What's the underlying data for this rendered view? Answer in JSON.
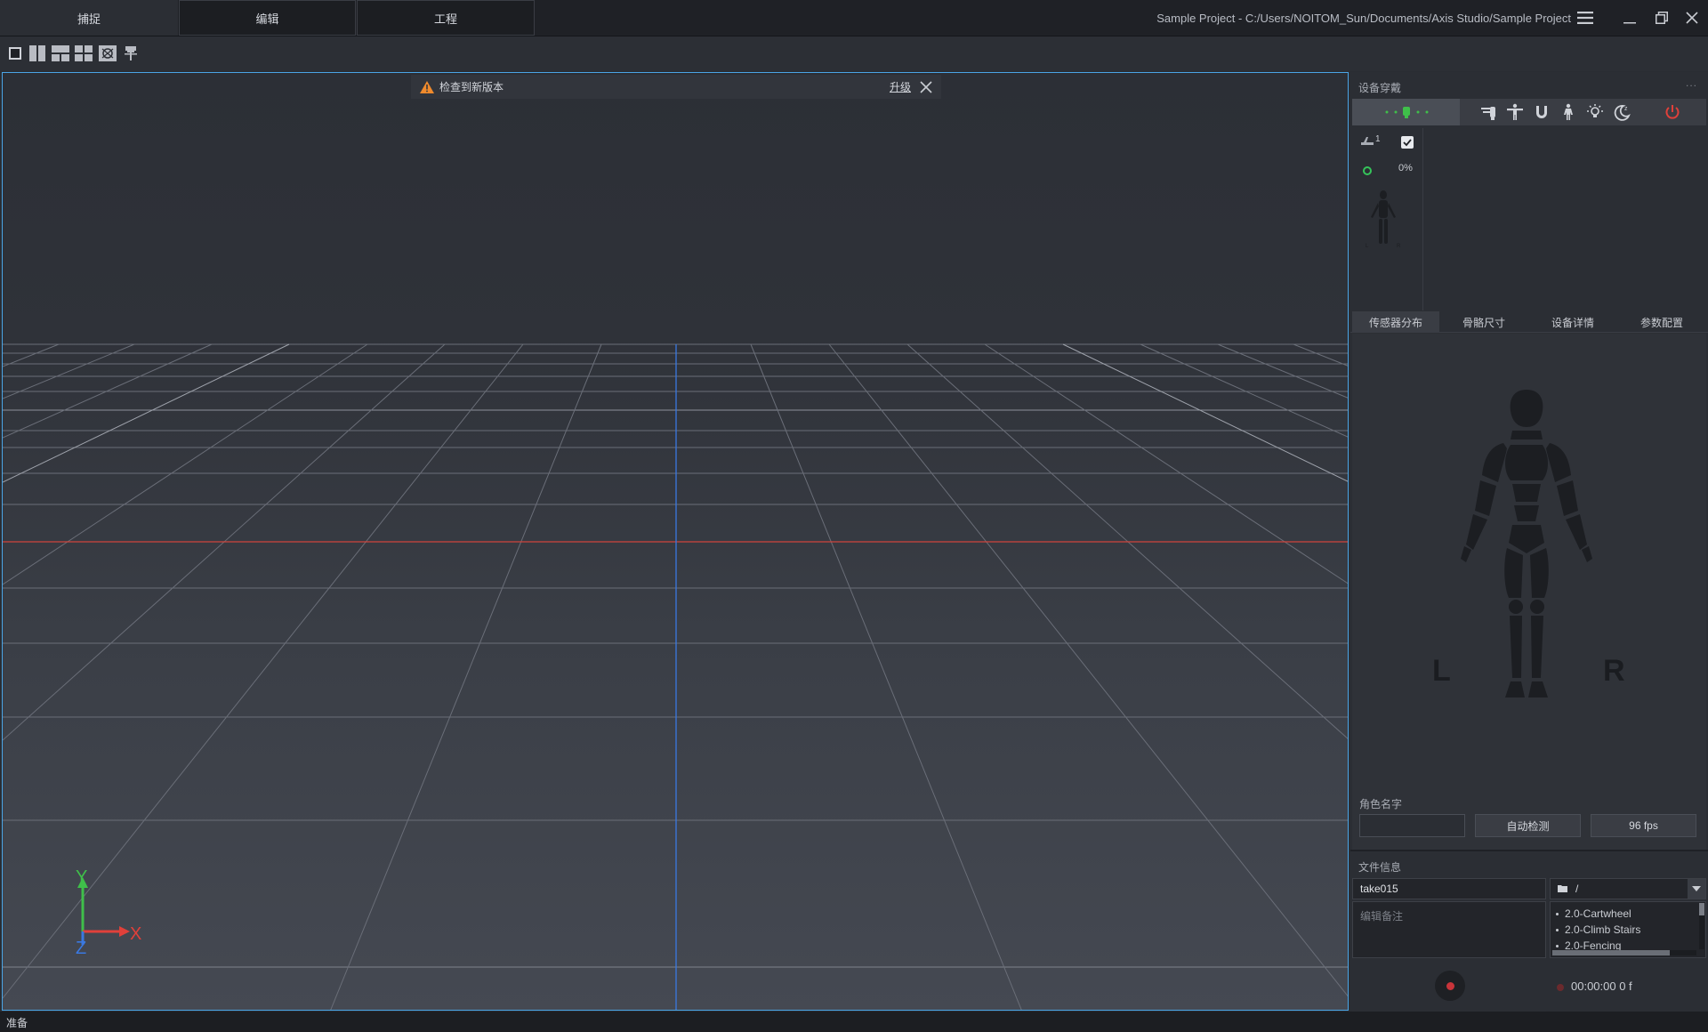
{
  "tabs": {
    "capture": "捕捉",
    "edit": "编辑",
    "project": "工程"
  },
  "window": {
    "title": "Sample Project - C:/Users/NOITOM_Sun/Documents/Axis Studio/Sample Project"
  },
  "toolbar": {
    "layouts": [
      "single-view-icon",
      "two-column-view-icon",
      "three-view-icon",
      "four-view-icon",
      "camera-view-icon",
      "pin-icon"
    ]
  },
  "notice": {
    "text": "检查到新版本",
    "upgrade": "升级"
  },
  "viewport": {
    "axes": {
      "y": "Y",
      "x": "X",
      "z": "Z"
    },
    "colors": {
      "x_axis": "#e0403a",
      "y_axis": "#3fbf4a",
      "z_axis": "#3a78e0",
      "border": "#4aa5e6"
    }
  },
  "right_panel": {
    "device_title": "设备穿戴",
    "more": "...",
    "device_tools": [
      "connect-icon",
      "hand-calibrate-icon",
      "t-pose-icon",
      "magnet-icon",
      "standing-figure-icon",
      "light-icon",
      "sleep-icon",
      "power-icon"
    ],
    "device": {
      "id": "1",
      "checked": true,
      "battery": "0%"
    },
    "tabs": {
      "sensors": "传感器分布",
      "bones": "骨骼尺寸",
      "details": "设备详情",
      "params": "参数配置"
    },
    "body": {
      "left": "L",
      "right": "R"
    },
    "role_label": "角色名字",
    "role_value": "",
    "auto_detect": "自动检测",
    "fps": "96 fps"
  },
  "file_info": {
    "title": "文件信息",
    "take_name": "take015",
    "folder": "/",
    "notes_placeholder": "编辑备注",
    "motions": [
      "2.0-Cartwheel",
      "2.0-Climb Stairs",
      "2.0-Fencing"
    ],
    "timecode": "00:00:00 0 f"
  },
  "status": {
    "text": "准备"
  }
}
